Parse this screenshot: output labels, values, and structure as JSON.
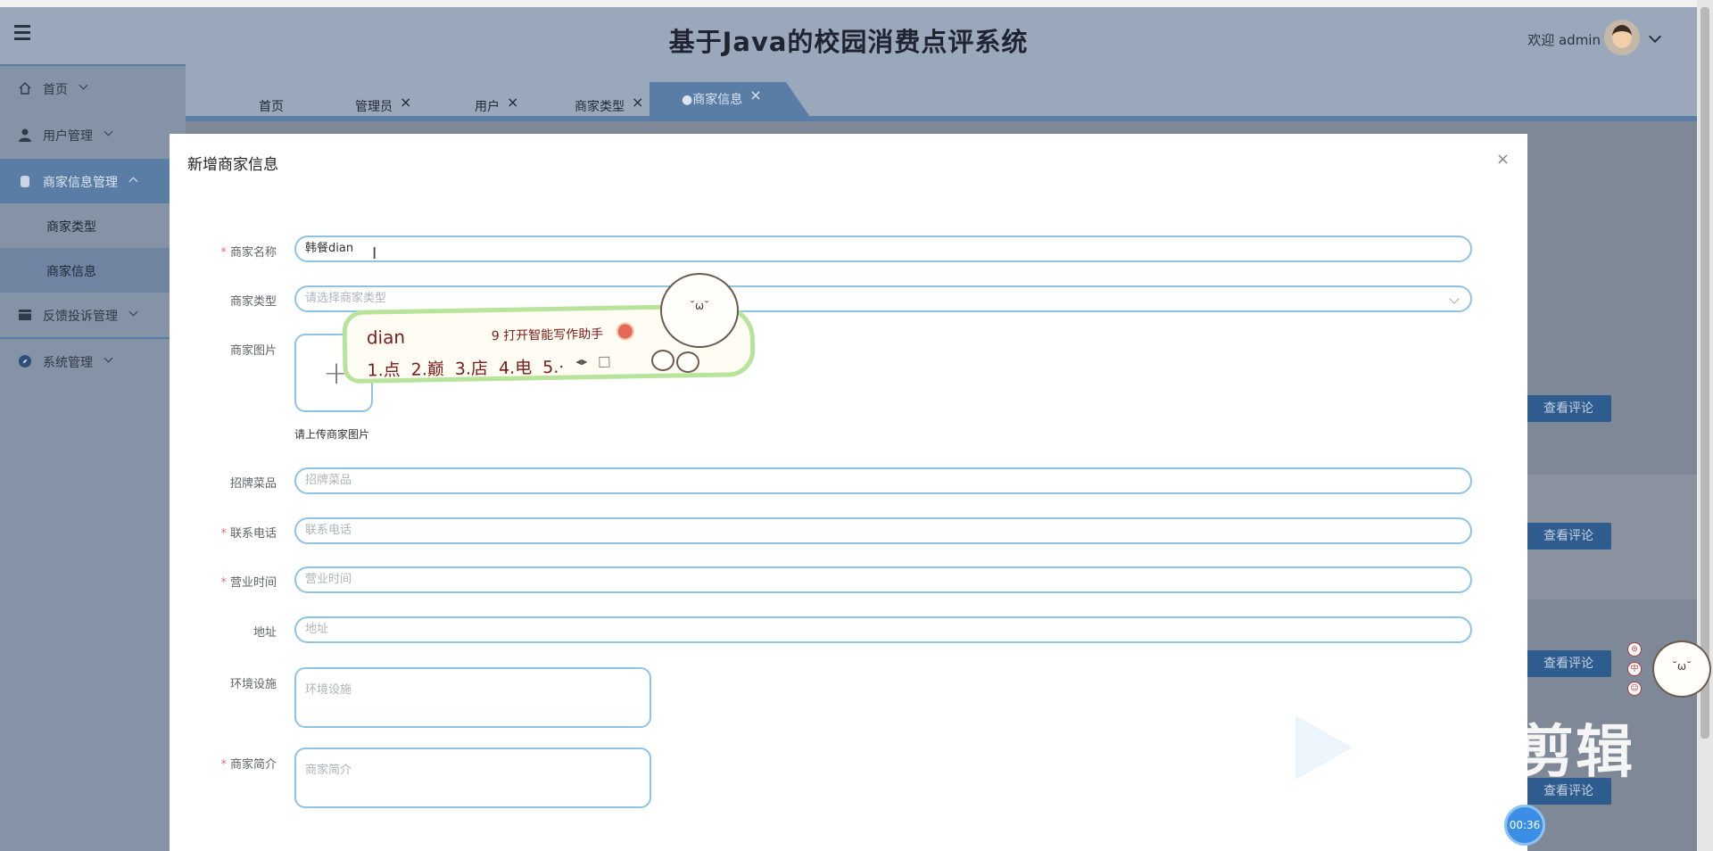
{
  "header": {
    "title": "基于Java的校园消费点评系统",
    "welcome": "欢迎 admin"
  },
  "sidebar": {
    "items": [
      {
        "label": "首页"
      },
      {
        "label": "用户管理"
      },
      {
        "label": "商家信息管理"
      },
      {
        "label": "反馈投诉管理"
      },
      {
        "label": "系统管理"
      }
    ],
    "subitems": [
      {
        "label": "商家类型"
      },
      {
        "label": "商家信息"
      }
    ]
  },
  "tabs": [
    {
      "label": "首页"
    },
    {
      "label": "管理员"
    },
    {
      "label": "用户"
    },
    {
      "label": "商家类型"
    },
    {
      "label": "●商家信息"
    }
  ],
  "background": {
    "action_label": "查看评论"
  },
  "dialog": {
    "title": "新增商家信息",
    "close_icon": "×",
    "fields": {
      "name": {
        "label": "商家名称",
        "value": "韩餐dian"
      },
      "type": {
        "label": "商家类型",
        "placeholder": "请选择商家类型"
      },
      "image": {
        "label": "商家图片",
        "hint": "请上传商家图片"
      },
      "dish": {
        "label": "招牌菜品",
        "placeholder": "招牌菜品"
      },
      "phone": {
        "label": "联系电话",
        "placeholder": "联系电话"
      },
      "hours": {
        "label": "营业时间",
        "placeholder": "营业时间"
      },
      "address": {
        "label": "地址",
        "placeholder": "地址"
      },
      "facilities": {
        "label": "环境设施",
        "placeholder": "环境设施"
      },
      "intro": {
        "label": "商家简介",
        "placeholder": "商家简介"
      }
    }
  },
  "ime": {
    "composition": "dian",
    "assistant": "9 打开智能写作助手",
    "candidates": "1.点  2.巅  3.店  4.电  5.·"
  },
  "floating": {
    "mini_icons": [
      "⊜",
      "中",
      "☺"
    ],
    "timer": "00:36",
    "watermark": "剪辑"
  }
}
